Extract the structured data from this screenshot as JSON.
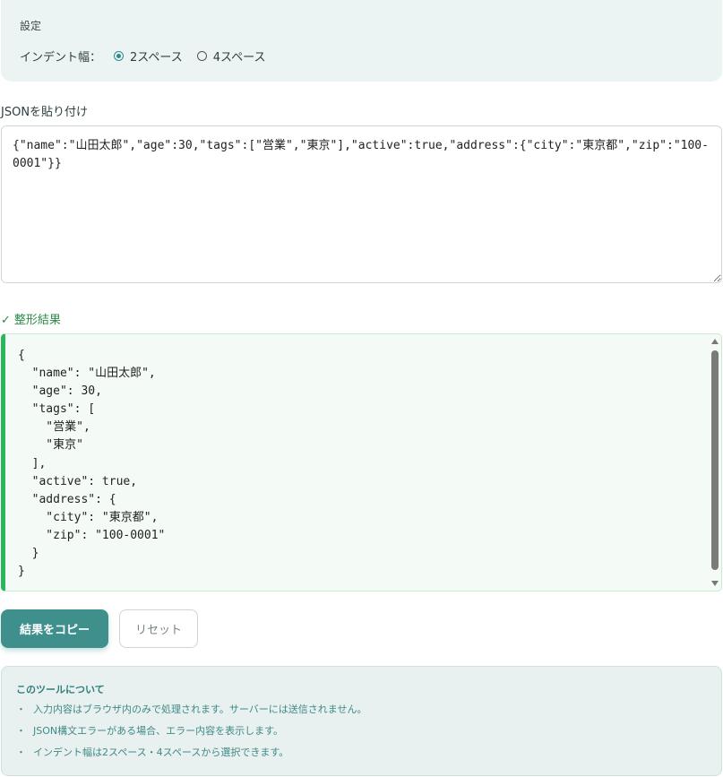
{
  "settings": {
    "title": "設定",
    "indent_label": "インデント幅：",
    "options": [
      {
        "label": "2スペース",
        "checked": true
      },
      {
        "label": "4スペース",
        "checked": false
      }
    ]
  },
  "input": {
    "label": "JSONを貼り付け",
    "value": "{\"name\":\"山田太郎\",\"age\":30,\"tags\":[\"営業\",\"東京\"],\"active\":true,\"address\":{\"city\":\"東京都\",\"zip\":\"100-0001\"}}"
  },
  "result": {
    "check_icon": "✓",
    "label": "整形結果",
    "text": "{\n  \"name\": \"山田太郎\",\n  \"age\": 30,\n  \"tags\": [\n    \"営業\",\n    \"東京\"\n  ],\n  \"active\": true,\n  \"address\": {\n    \"city\": \"東京都\",\n    \"zip\": \"100-0001\"\n  }\n}"
  },
  "buttons": {
    "copy": "結果をコピー",
    "reset": "リセット"
  },
  "about": {
    "title": "このツールについて",
    "items": [
      "入力内容はブラウザ内のみで処理されます。サーバーには送信されません。",
      "JSON構文エラーがある場合、エラー内容を表示します。",
      "インデント幅は2スペース・4スペースから選択できます。"
    ],
    "bullet": "・"
  },
  "colors": {
    "accent": "#3f8f8c",
    "success": "#2bb55d"
  }
}
